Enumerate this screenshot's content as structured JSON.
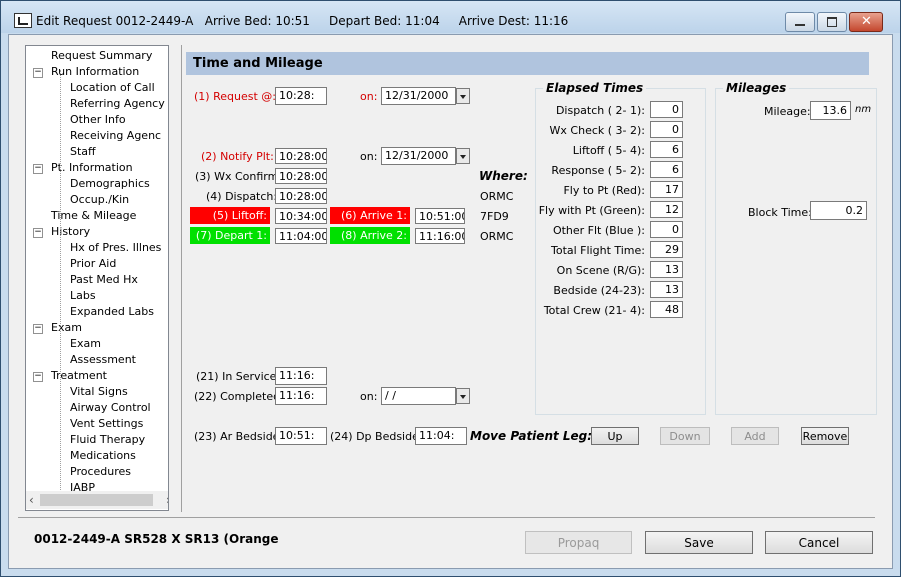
{
  "window": {
    "icon": "form-icon",
    "title": "Edit Request 0012-2449-A",
    "arrive_bed": "Arrive Bed: 10:51",
    "depart_bed": "Depart Bed: 11:04",
    "arrive_dest": "Arrive Dest: 11:16"
  },
  "tree": [
    {
      "label": "Request Summary",
      "level": 0,
      "expander": ""
    },
    {
      "label": "Run Information",
      "level": 0,
      "expander": "−"
    },
    {
      "label": "Location of Call",
      "level": 1
    },
    {
      "label": "Referring Agency",
      "level": 1
    },
    {
      "label": "Other Info",
      "level": 1
    },
    {
      "label": "Receiving Agenc",
      "level": 1
    },
    {
      "label": "Staff",
      "level": 1
    },
    {
      "label": "Pt. Information",
      "level": 0,
      "expander": "−"
    },
    {
      "label": "Demographics",
      "level": 1
    },
    {
      "label": "Occup./Kin",
      "level": 1
    },
    {
      "label": "Time & Mileage",
      "level": 0,
      "expander": ""
    },
    {
      "label": "History",
      "level": 0,
      "expander": "−"
    },
    {
      "label": "Hx of Pres. Illnes",
      "level": 1
    },
    {
      "label": "Prior Aid",
      "level": 1
    },
    {
      "label": "Past Med Hx",
      "level": 1
    },
    {
      "label": "Labs",
      "level": 1
    },
    {
      "label": "Expanded Labs",
      "level": 1
    },
    {
      "label": "Exam",
      "level": 0,
      "expander": "−"
    },
    {
      "label": "Exam",
      "level": 1
    },
    {
      "label": "Assessment",
      "level": 1
    },
    {
      "label": "Treatment",
      "level": 0,
      "expander": "−"
    },
    {
      "label": "Vital Signs",
      "level": 1
    },
    {
      "label": "Airway Control",
      "level": 1
    },
    {
      "label": "Vent Settings",
      "level": 1
    },
    {
      "label": "Fluid Therapy",
      "level": 1
    },
    {
      "label": "Medications",
      "level": 1
    },
    {
      "label": "Procedures",
      "level": 1
    },
    {
      "label": "IABP",
      "level": 1
    }
  ],
  "section_title": "Time and Mileage",
  "times": {
    "request_label": "(1) Request @:",
    "request_value": "10:28:",
    "on_label": "on:",
    "request_date": "12/31/2000",
    "notify_label": "(2) Notify Plt:",
    "notify_value": "10:28:00",
    "notify_date": "12/31/2000",
    "wx_label": "(3) Wx Confirm:",
    "wx_value": "10:28:00",
    "dispatch_label": "(4) Dispatch:",
    "dispatch_value": "10:28:00",
    "liftoff_label": "(5) Liftoff:",
    "liftoff_value": "10:34:00",
    "arrive1_label": "(6) Arrive 1:",
    "arrive1_value": "10:51:00",
    "depart1_label": "(7) Depart 1:",
    "depart1_value": "11:04:00",
    "arrive2_label": "(8) Arrive 2:",
    "arrive2_value": "11:16:00",
    "where_label": "Where:",
    "where_dispatch": "ORMC",
    "where_arrive1": "7FD9",
    "where_arrive2": "ORMC",
    "inservice_label": "(21) In Service:",
    "inservice_value": "11:16:",
    "completed_label": "(22) Completed:",
    "completed_value": "11:16:",
    "completed_date": " / /",
    "ar_bedside_label": "(23) Ar Bedside:",
    "ar_bedside_value": "10:51:",
    "dp_bedside_label": "(24) Dp Bedside:",
    "dp_bedside_value": "11:04:"
  },
  "colors": {
    "liftoff_bg": "#ff0000",
    "arrive1_bg": "#ff0000",
    "depart1_bg": "#00e000",
    "arrive2_bg": "#00e000",
    "section_bg": "#b0c4de"
  },
  "elapsed": {
    "title": "Elapsed Times",
    "rows": [
      {
        "label": "Dispatch ( 2- 1):",
        "value": "0"
      },
      {
        "label": "Wx Check ( 3- 2):",
        "value": "0"
      },
      {
        "label": "Liftoff ( 5- 4):",
        "value": "6"
      },
      {
        "label": "Response ( 5- 2):",
        "value": "6"
      },
      {
        "label": "Fly to Pt (Red):",
        "value": "17"
      },
      {
        "label": "Fly with Pt (Green):",
        "value": "12"
      },
      {
        "label": "Other Flt (Blue ):",
        "value": "0"
      },
      {
        "label": "Total Flight Time:",
        "value": "29"
      },
      {
        "label": "On Scene (R/G):",
        "value": "13"
      },
      {
        "label": "Bedside (24-23):",
        "value": "13"
      },
      {
        "label": "Total Crew (21- 4):",
        "value": "48"
      }
    ]
  },
  "mileages": {
    "title": "Mileages",
    "mileage_label": "Mileage:",
    "mileage_value": "13.6",
    "mileage_unit": "nm",
    "block_label": "Block Time:",
    "block_value": "0.2"
  },
  "move_leg": {
    "label": "Move Patient Leg:",
    "up": "Up",
    "down": "Down",
    "add": "Add",
    "remove": "Remove"
  },
  "footer": {
    "summary": "0012-2449-A  SR528 X SR13 (Orange",
    "propaq": "Propaq",
    "save": "Save",
    "cancel": "Cancel"
  }
}
